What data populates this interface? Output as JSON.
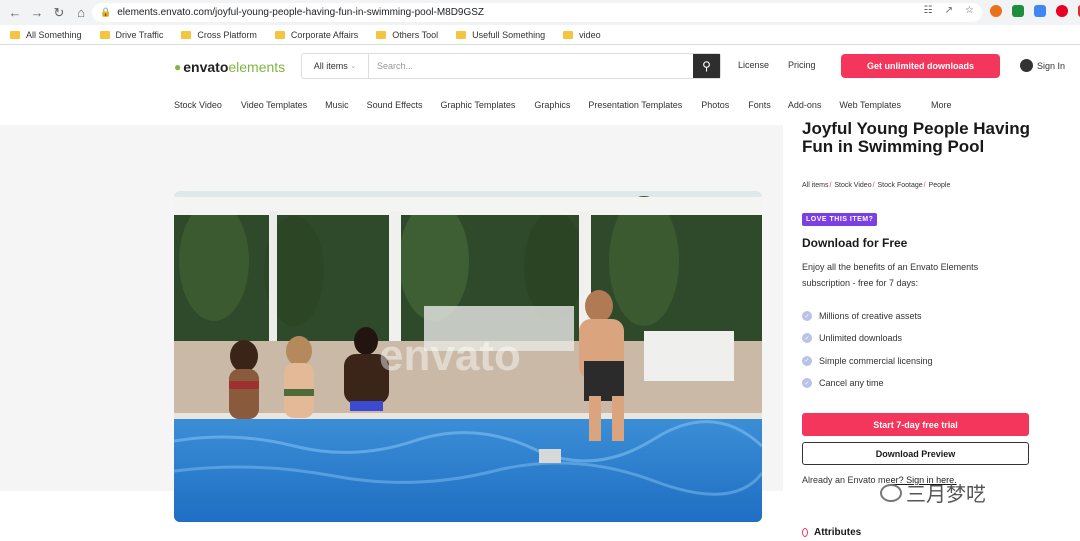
{
  "browser": {
    "url": "elements.envato.com/joyful-young-people-having-fun-in-swimming-pool-M8D9GSZ",
    "bookmarks": [
      "All Something",
      "Drive Traffic",
      "Cross Platform",
      "Corporate Affairs",
      "Others Tool",
      "Usefull Something",
      "video"
    ]
  },
  "header": {
    "logo_main": "envato",
    "logo_sub": "elements",
    "search_category": "All items",
    "search_placeholder": "Search...",
    "license": "License",
    "pricing": "Pricing",
    "cta": "Get unlimited downloads",
    "signin": "Sign In",
    "categories": [
      "Stock Video",
      "Video Templates",
      "Music",
      "Sound Effects",
      "Graphic Templates",
      "Graphics",
      "Presentation Templates",
      "Photos",
      "Fonts",
      "Add-ons",
      "Web Templates",
      "More"
    ]
  },
  "item": {
    "title": "Joyful Young People Having Fun in Swimming Pool",
    "breadcrumbs": [
      "All items",
      "Stock Video",
      "Stock Footage",
      "People"
    ],
    "video_watermark": "envato",
    "love_badge": "LOVE THIS ITEM?",
    "download_heading": "Download for Free",
    "benefits_text": "Enjoy all the benefits of an Envato Elements subscription - free for 7 days:",
    "features": [
      "Millions of creative assets",
      "Unlimited downloads",
      "Simple commercial licensing",
      "Cancel any time"
    ],
    "trial_button": "Start 7-day free trial",
    "preview_button": "Download Preview",
    "already_member": "Already an Envato me",
    "already_member_tail": "er? Sign in here.",
    "attributes_heading": "Attributes"
  },
  "overlay": {
    "watermark_text": "三月梦呓"
  },
  "colors": {
    "brand_green": "#82b541",
    "cta_red": "#f5365c",
    "badge_purple": "#7b3fe4"
  }
}
